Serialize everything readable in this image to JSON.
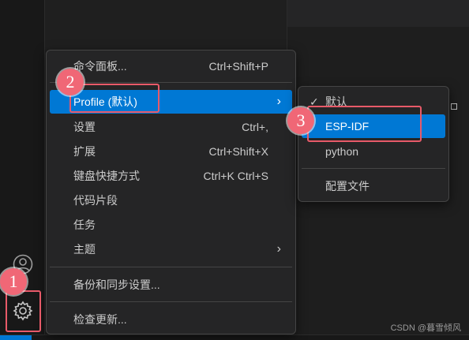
{
  "main_menu": {
    "items": [
      {
        "label": "命令面板...",
        "shortcut": "Ctrl+Shift+P"
      },
      {
        "label": "Profile (默认)",
        "submenu": true
      },
      {
        "label": "设置",
        "shortcut": "Ctrl+,"
      },
      {
        "label": "扩展",
        "shortcut": "Ctrl+Shift+X"
      },
      {
        "label": "键盘快捷方式",
        "shortcut": "Ctrl+K Ctrl+S"
      },
      {
        "label": "代码片段"
      },
      {
        "label": "任务"
      },
      {
        "label": "主题",
        "submenu": true
      },
      {
        "label": "备份和同步设置..."
      },
      {
        "label": "检查更新..."
      }
    ]
  },
  "profile_submenu": {
    "items": [
      {
        "label": "默认",
        "checked": true
      },
      {
        "label": "ESP-IDF"
      },
      {
        "label": "python"
      },
      {
        "label": "配置文件"
      }
    ]
  },
  "annotations": {
    "step1": "1",
    "step2": "2",
    "step3": "3"
  },
  "watermark": "CSDN @暮雪倾风",
  "colors": {
    "accent": "#0078d4",
    "annotation": "#e85a69",
    "menu_bg": "#252526"
  },
  "icons": {
    "account": "account-icon",
    "manage": "gear-icon",
    "chevron": "chevron-right-icon",
    "check": "check-icon"
  }
}
